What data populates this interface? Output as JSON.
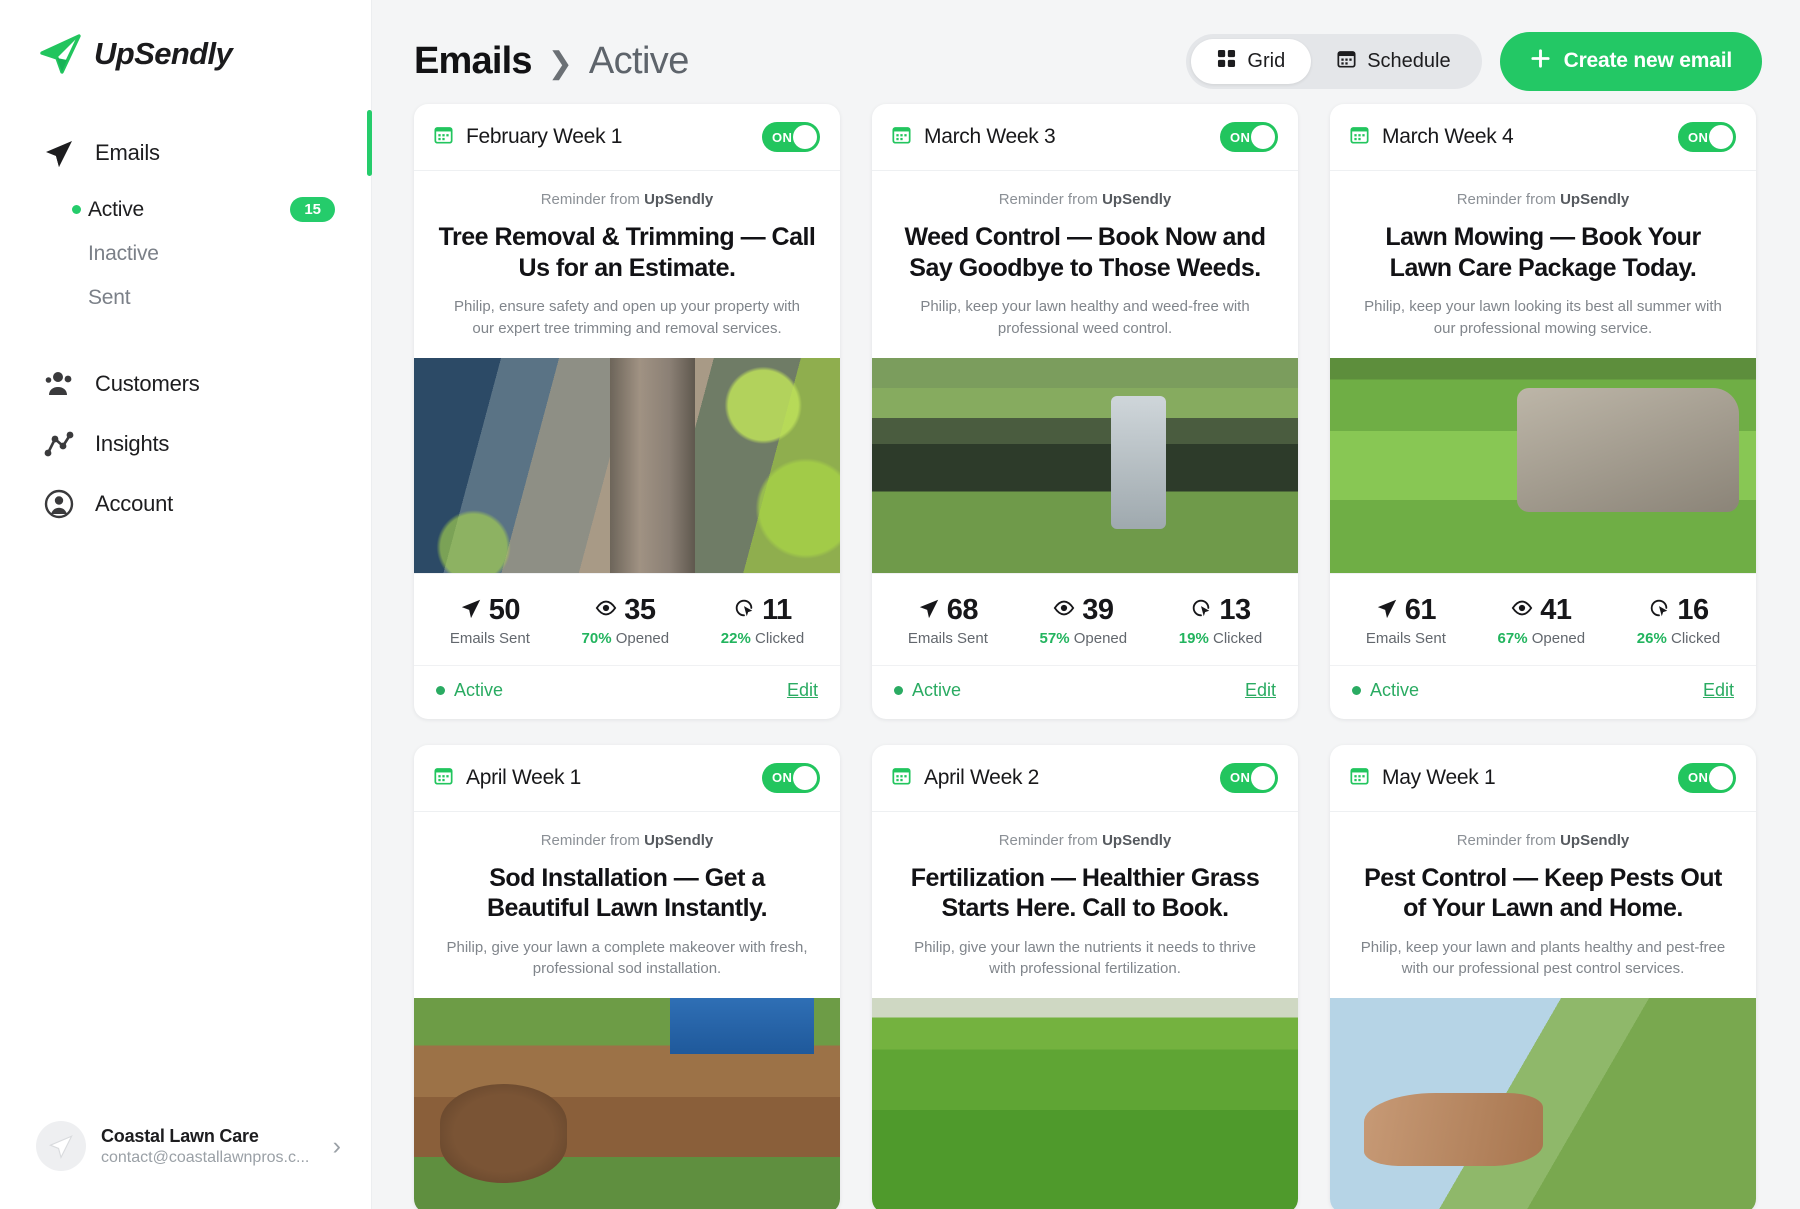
{
  "brand": {
    "name_part1": "Up",
    "name_part2": "Sendly",
    "logo_icon": "paper-plane-icon"
  },
  "sidebar": {
    "nav": [
      {
        "label": "Emails",
        "icon": "paper-plane-icon"
      },
      {
        "label": "Customers",
        "icon": "users-icon"
      },
      {
        "label": "Insights",
        "icon": "chart-network-icon"
      },
      {
        "label": "Account",
        "icon": "user-circle-icon"
      }
    ],
    "subnav": [
      {
        "label": "Active",
        "badge": "15",
        "active": true
      },
      {
        "label": "Inactive",
        "badge": "",
        "active": false
      },
      {
        "label": "Sent",
        "badge": "",
        "active": false
      }
    ],
    "footer": {
      "account_name": "Coastal Lawn Care",
      "account_email": "contact@coastallawnpros.c...",
      "chevron": "›"
    }
  },
  "header": {
    "breadcrumb_root": "Emails",
    "breadcrumb_sep": "❯",
    "breadcrumb_leaf": "Active",
    "view_toggle": [
      {
        "label": "Grid",
        "icon": "grid-icon",
        "active": true
      },
      {
        "label": "Schedule",
        "icon": "calendar-icon",
        "active": false
      }
    ],
    "create_button": {
      "label": "Create new email",
      "icon": "plus-icon"
    }
  },
  "labels": {
    "kicker_prefix": "Reminder from ",
    "kicker_brand": "UpSendly",
    "toggle_on": "ON",
    "sent_label": "Emails Sent",
    "opened_label": "Opened",
    "clicked_label": "Clicked",
    "status_active": "Active",
    "edit_link": "Edit"
  },
  "cards": [
    {
      "week": "February Week 1",
      "toggle": "ON",
      "headline": "Tree Removal & Trimming — Call Us for an Estimate.",
      "sub": "Philip, ensure safety and open up your property with our expert tree trimming and removal services.",
      "photo": "chainsaw-cutting-tree",
      "sent": "50",
      "opened": "35",
      "opened_pct": "70%",
      "clicked": "11",
      "clicked_pct": "22%",
      "status": "Active",
      "edit": "Edit"
    },
    {
      "week": "March Week 3",
      "toggle": "ON",
      "headline": "Weed Control — Book Now and Say Goodbye to Those Weeds.",
      "sub": "Philip, keep your lawn healthy and weed-free with professional weed control.",
      "photo": "worker-spraying-weeds",
      "sent": "68",
      "opened": "39",
      "opened_pct": "57%",
      "clicked": "13",
      "clicked_pct": "19%",
      "status": "Active",
      "edit": "Edit"
    },
    {
      "week": "March Week 4",
      "toggle": "ON",
      "headline": "Lawn Mowing — Book Your Lawn Care Package Today.",
      "sub": "Philip, keep your lawn looking its best all summer with our professional mowing service.",
      "photo": "lawn-mower-on-grass",
      "sent": "61",
      "opened": "41",
      "opened_pct": "67%",
      "clicked": "16",
      "clicked_pct": "26%",
      "status": "Active",
      "edit": "Edit"
    },
    {
      "week": "April Week 1",
      "toggle": "ON",
      "headline": "Sod Installation — Get a Beautiful Lawn Instantly.",
      "sub": "Philip, give your lawn a complete makeover with fresh, professional sod installation.",
      "photo": "sod-rolls-being-laid",
      "sent": "",
      "opened": "",
      "opened_pct": "",
      "clicked": "",
      "clicked_pct": "",
      "status": "",
      "edit": ""
    },
    {
      "week": "April Week 2",
      "toggle": "ON",
      "headline": "Fertilization — Healthier Grass Starts Here. Call to Book.",
      "sub": "Philip, give your lawn the nutrients it needs to thrive with professional fertilization.",
      "photo": "close-up-green-grass",
      "sent": "",
      "opened": "",
      "opened_pct": "",
      "clicked": "",
      "clicked_pct": "",
      "status": "",
      "edit": ""
    },
    {
      "week": "May Week 1",
      "toggle": "ON",
      "headline": "Pest Control — Keep Pests Out of Your Lawn and Home.",
      "sub": "Philip, keep your lawn and plants healthy and pest-free with our professional pest control services.",
      "photo": "spraying-pest-control",
      "sent": "",
      "opened": "",
      "opened_pct": "",
      "clicked": "",
      "clicked_pct": "",
      "status": "",
      "edit": ""
    }
  ],
  "colors": {
    "accent": "#23c865",
    "accent_dark": "#2aab62",
    "text": "#121214",
    "muted": "#80858b"
  }
}
